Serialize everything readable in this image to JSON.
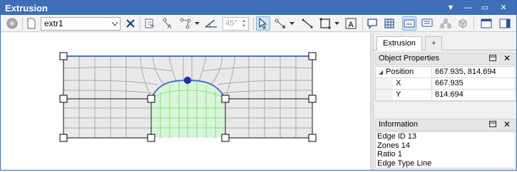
{
  "window": {
    "title": "Extrusion"
  },
  "toolbar": {
    "zone_combo_value": "extr1",
    "angle_value": "45°"
  },
  "right_panel": {
    "tabs": [
      {
        "label": "Extrusion"
      },
      {
        "label": "+"
      }
    ],
    "object_properties": {
      "title": "Object Properties",
      "rows": [
        {
          "key": "Position",
          "value": "667.935, 814.694"
        },
        {
          "key": "X",
          "value": "667.935"
        },
        {
          "key": "Y",
          "value": "814.694"
        }
      ]
    },
    "information": {
      "title": "Information",
      "lines": [
        "Edge ID  13",
        "Zones  14",
        "Ratio  1",
        "Edge Type  Line"
      ]
    }
  },
  "colors": {
    "titlebar": "#3f6fb6",
    "mesh_fill": "#e9e9e9",
    "mesh_line": "#a8a8a8",
    "zone_fill": "#d8f5d8",
    "zone_line": "#7fdd7f",
    "selected_edge": "#4a72c8"
  }
}
